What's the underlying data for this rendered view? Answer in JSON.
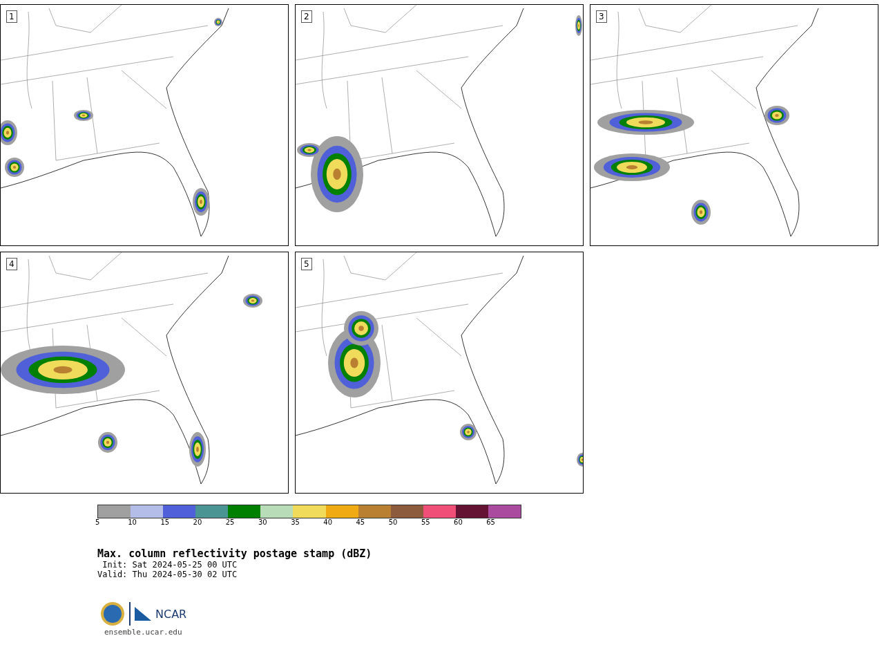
{
  "panels": [
    {
      "label": "1"
    },
    {
      "label": "2"
    },
    {
      "label": "3"
    },
    {
      "label": "4"
    },
    {
      "label": "5"
    }
  ],
  "colorbar": {
    "segments": [
      {
        "color": "#a0a0a0"
      },
      {
        "color": "#b4bce8"
      },
      {
        "color": "#5060d8"
      },
      {
        "color": "#4a9494"
      },
      {
        "color": "#008000"
      },
      {
        "color": "#b8dcb8"
      },
      {
        "color": "#f0dc5a"
      },
      {
        "color": "#f0aa14"
      },
      {
        "color": "#b88030"
      },
      {
        "color": "#8c5a3c"
      },
      {
        "color": "#f05078"
      },
      {
        "color": "#641432"
      },
      {
        "color": "#aa4ba0"
      }
    ],
    "ticks": [
      "5",
      "10",
      "15",
      "20",
      "25",
      "30",
      "35",
      "40",
      "45",
      "50",
      "55",
      "60",
      "65"
    ]
  },
  "title": "Max. column reflectivity postage stamp (dBZ)",
  "init": " Init: Sat 2024-05-25 00 UTC",
  "valid": "Valid: Thu 2024-05-30 02 UTC",
  "logo": {
    "text": "NCAR",
    "url": "ensemble.ucar.edu"
  }
}
